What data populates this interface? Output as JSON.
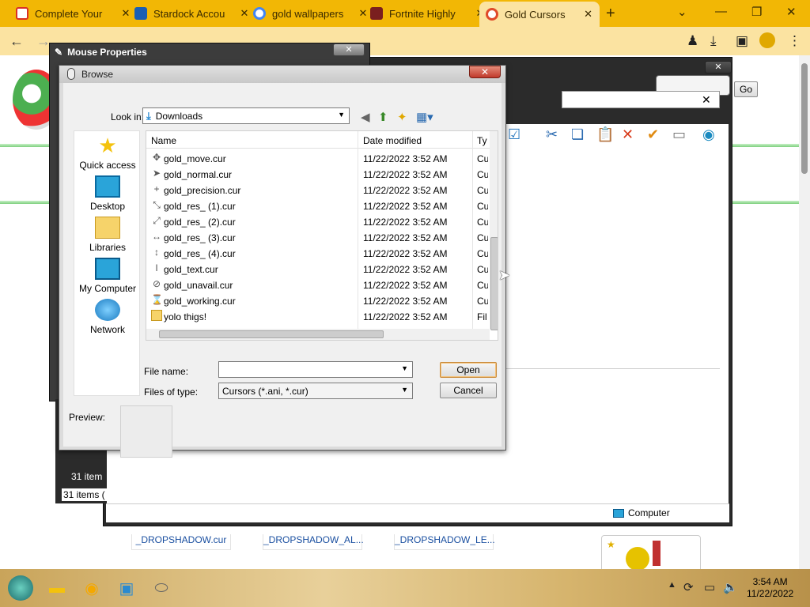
{
  "browser": {
    "tabs": [
      {
        "label": "Complete Your",
        "icon": "gmail-icon",
        "color": "#d93025"
      },
      {
        "label": "Stardock Accou",
        "icon": "stardock-icon",
        "color": "#1a5fb4"
      },
      {
        "label": "gold wallpapers",
        "icon": "google-icon",
        "color": "#4285f4"
      },
      {
        "label": "Fortnite Highly",
        "icon": "fortnite-icon",
        "color": "#7a1f1f"
      },
      {
        "label": "Gold Cursors",
        "icon": "gold-cursors-icon",
        "color": "#e04a2a"
      }
    ],
    "new_tab": "+"
  },
  "explorer": {
    "go_button": "Go",
    "status_items_1": "31 item",
    "status_items_2": "31 items (",
    "computer_label": "Computer",
    "files_below": [
      "_DROPSHADOW.cur",
      "_DROPSHADOW_AL...",
      "_DROPSHADOW_LE..."
    ]
  },
  "mouse_properties": {
    "title": "Mouse Properties"
  },
  "browse_dialog": {
    "title": "Browse",
    "look_in_label": "Look in:",
    "look_in_value": "Downloads",
    "places": [
      "Quick access",
      "Desktop",
      "Libraries",
      "My Computer",
      "Network"
    ],
    "columns": {
      "name": "Name",
      "date": "Date modified",
      "type": "Ty"
    },
    "files": [
      {
        "name": "gold_move.cur",
        "date": "11/22/2022 3:52 AM",
        "type": "Cu",
        "icon": "move-cursor-icon",
        "glyph": "✥"
      },
      {
        "name": "gold_normal.cur",
        "date": "11/22/2022 3:52 AM",
        "type": "Cu",
        "icon": "arrow-cursor-icon",
        "glyph": "➤"
      },
      {
        "name": "gold_precision.cur",
        "date": "11/22/2022 3:52 AM",
        "type": "Cu",
        "icon": "crosshair-cursor-icon",
        "glyph": "+"
      },
      {
        "name": "gold_res_ (1).cur",
        "date": "11/22/2022 3:52 AM",
        "type": "Cu",
        "icon": "resize-diag1-icon",
        "glyph": "⤡"
      },
      {
        "name": "gold_res_ (2).cur",
        "date": "11/22/2022 3:52 AM",
        "type": "Cu",
        "icon": "resize-diag2-icon",
        "glyph": "⤢"
      },
      {
        "name": "gold_res_ (3).cur",
        "date": "11/22/2022 3:52 AM",
        "type": "Cu",
        "icon": "resize-horizontal-icon",
        "glyph": "↔"
      },
      {
        "name": "gold_res_ (4).cur",
        "date": "11/22/2022 3:52 AM",
        "type": "Cu",
        "icon": "resize-vertical-icon",
        "glyph": "↕"
      },
      {
        "name": "gold_text.cur",
        "date": "11/22/2022 3:52 AM",
        "type": "Cu",
        "icon": "text-cursor-icon",
        "glyph": "I"
      },
      {
        "name": "gold_unavail.cur",
        "date": "11/22/2022 3:52 AM",
        "type": "Cu",
        "icon": "unavailable-cursor-icon",
        "glyph": "⊘"
      },
      {
        "name": "gold_working.cur",
        "date": "11/22/2022 3:52 AM",
        "type": "Cu",
        "icon": "working-cursor-icon",
        "glyph": "⌛"
      },
      {
        "name": "yolo thigs!",
        "date": "11/22/2022 3:52 AM",
        "type": "Fil",
        "icon": "folder-icon",
        "glyph": "▭"
      }
    ],
    "file_name_label": "File name:",
    "file_name_value": "",
    "files_of_type_label": "Files of type:",
    "files_of_type_value": "Cursors (*.ani, *.cur)",
    "open_button": "Open",
    "cancel_button": "Cancel",
    "preview_label": "Preview:"
  },
  "taskbar": {
    "time": "3:54 AM",
    "date": "11/22/2022"
  }
}
